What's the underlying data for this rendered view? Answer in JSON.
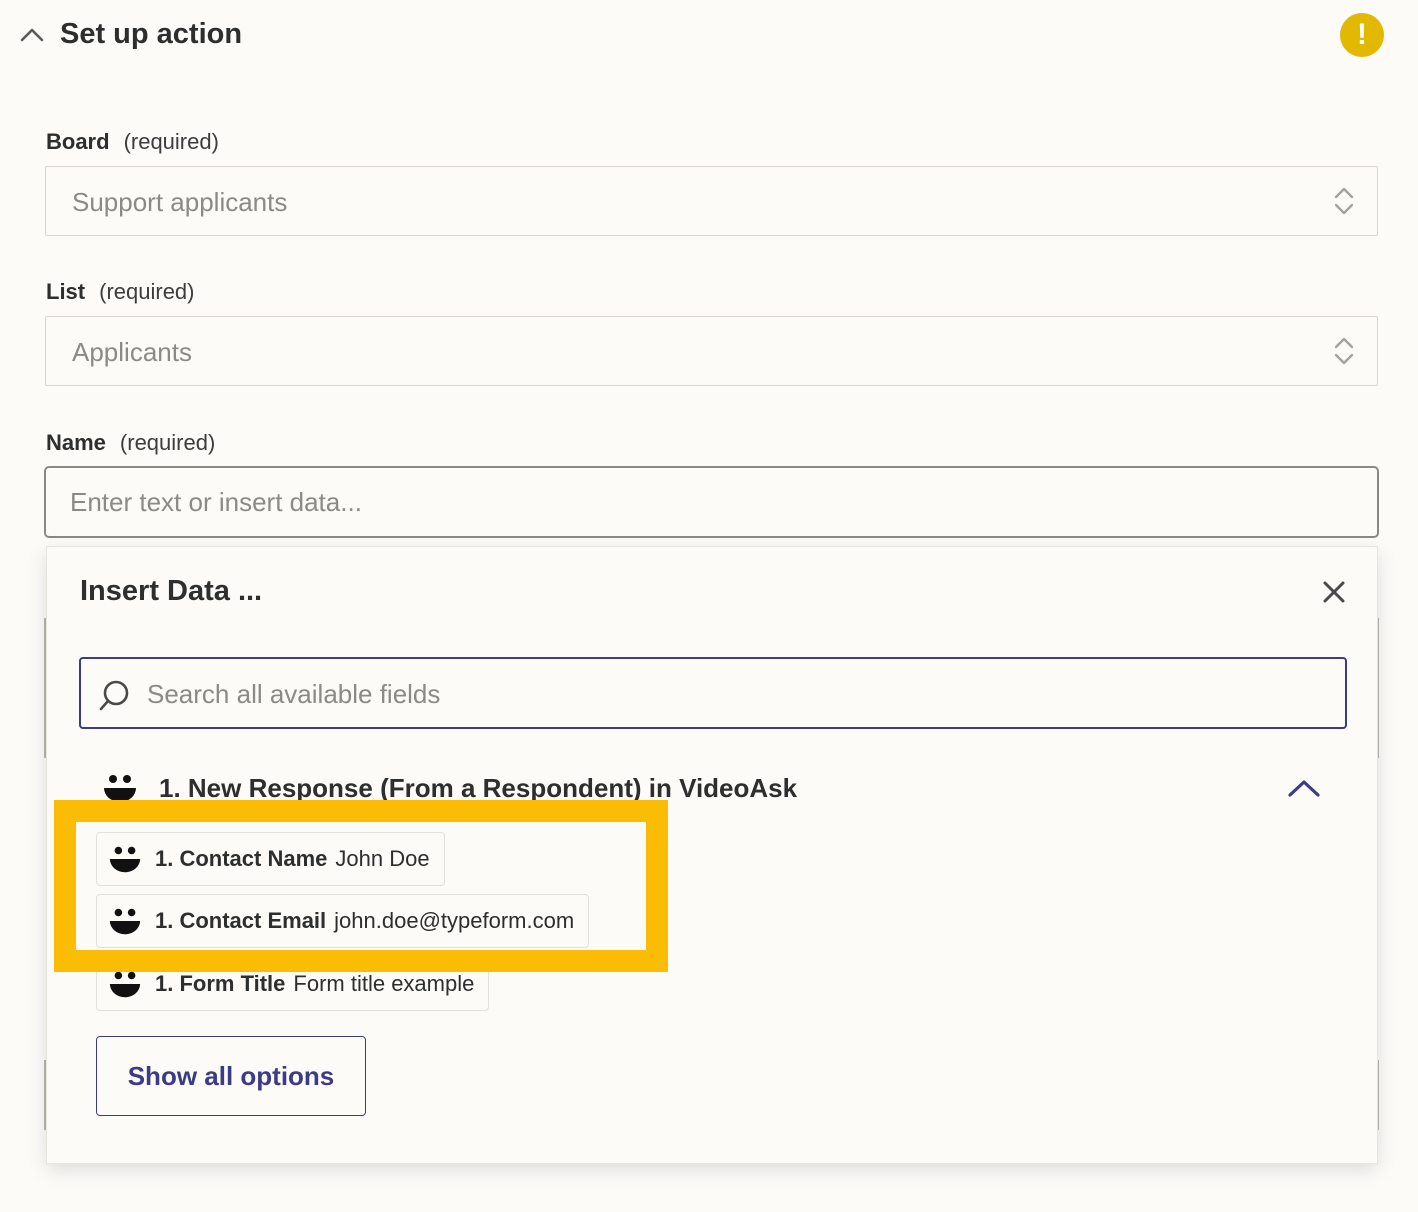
{
  "header": {
    "title": "Set up action",
    "warning_symbol": "!",
    "warning_color": "#e2b800"
  },
  "fields": {
    "board": {
      "label": "Board",
      "required": "(required)",
      "value": "Support applicants"
    },
    "list": {
      "label": "List",
      "required": "(required)",
      "value": "Applicants"
    },
    "name": {
      "label": "Name",
      "required": "(required)",
      "placeholder": "Enter text or insert data..."
    }
  },
  "popover": {
    "title": "Insert Data ...",
    "search_placeholder": "Search all available fields",
    "group": {
      "title": "1. New Response (From a Respondent) in VideoAsk",
      "app_icon": "videoask-face-icon"
    },
    "items": [
      {
        "label": "1. Contact Name",
        "value": "John Doe"
      },
      {
        "label": "1. Contact Email",
        "value": "john.doe@typeform.com"
      },
      {
        "label": "1. Form Title",
        "value": "Form title example"
      }
    ],
    "show_all_label": "Show all options"
  },
  "colors": {
    "accent": "#3c3b86",
    "highlight": "#fbbc05",
    "background": "#fcfbf8"
  }
}
